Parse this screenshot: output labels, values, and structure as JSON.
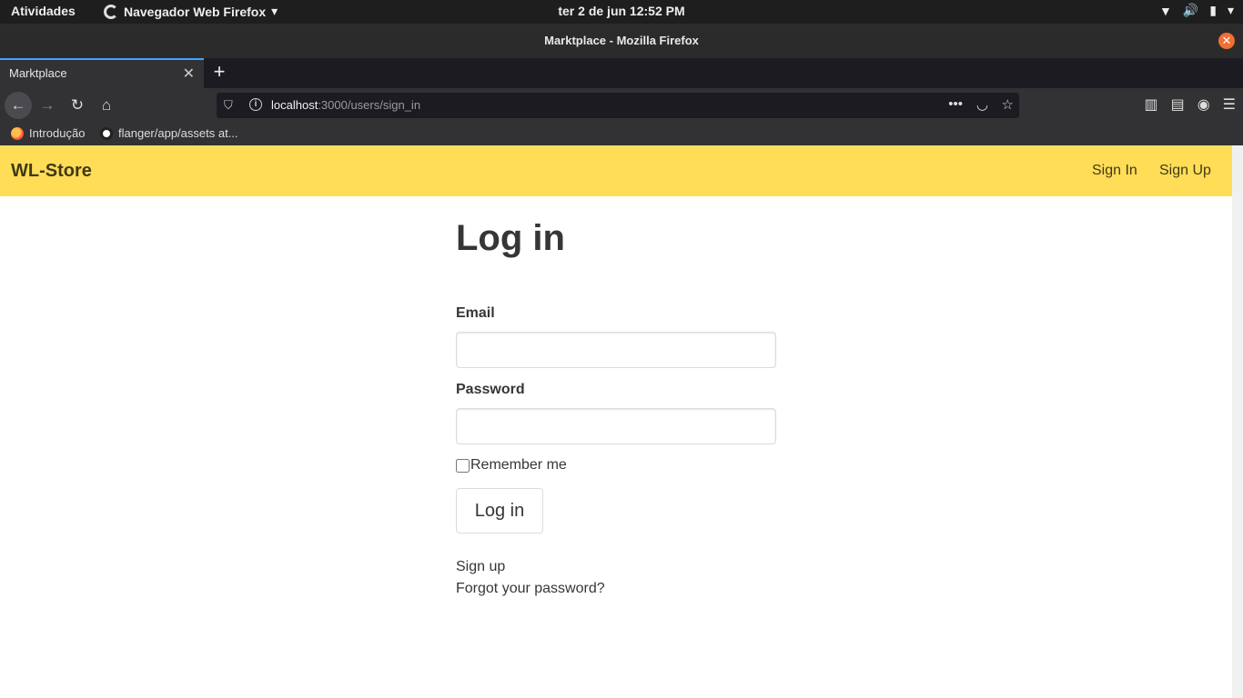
{
  "os_bar": {
    "activities": "Atividades",
    "app_name": "Navegador Web Firefox",
    "clock": "ter 2 de jun  12:52 PM"
  },
  "window": {
    "title": "Marktplace - Mozilla Firefox"
  },
  "tabs": [
    {
      "label": "Marktplace",
      "active": true
    }
  ],
  "address_bar": {
    "host": "localhost",
    "path": ":3000/users/sign_in"
  },
  "bookmarks": [
    {
      "label": "Introdução",
      "icon": "firefox-icon"
    },
    {
      "label": "flanger/app/assets at...",
      "icon": "github-icon"
    }
  ],
  "site": {
    "brand": "WL-Store",
    "nav": {
      "sign_in": "Sign In",
      "sign_up": "Sign Up"
    },
    "accent_color": "#ffdd57"
  },
  "login_form": {
    "heading": "Log in",
    "email_label": "Email",
    "email_value": "",
    "password_label": "Password",
    "password_value": "",
    "remember_label": "Remember me",
    "remember_checked": false,
    "submit_label": "Log in",
    "signup_link": "Sign up",
    "forgot_link": "Forgot your password?"
  }
}
